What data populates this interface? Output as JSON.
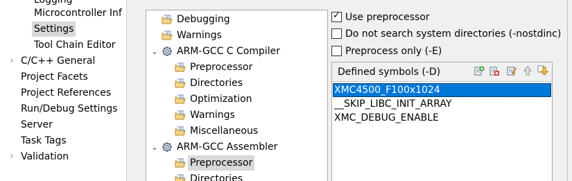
{
  "left_nav": {
    "items": [
      {
        "label": "Logging",
        "expandable": false
      },
      {
        "label": "Microcontroller Inf",
        "expandable": false
      },
      {
        "label": "Settings",
        "expandable": false,
        "selected": true
      },
      {
        "label": "Tool Chain Editor",
        "expandable": false
      },
      {
        "label": "C/C++ General",
        "expandable": true
      },
      {
        "label": "Project Facets",
        "expandable": false
      },
      {
        "label": "Project References",
        "expandable": false
      },
      {
        "label": "Run/Debug Settings",
        "expandable": false
      },
      {
        "label": "Server",
        "expandable": false
      },
      {
        "label": "Task Tags",
        "expandable": false
      },
      {
        "label": "Validation",
        "expandable": true
      }
    ]
  },
  "tool_tree": {
    "items": [
      {
        "label": "Debugging",
        "kind": "folder",
        "expandable": false
      },
      {
        "label": "Warnings",
        "kind": "folder",
        "expandable": false
      },
      {
        "label": "ARM-GCC C Compiler",
        "kind": "tool",
        "expandable": true,
        "expanded": true
      },
      {
        "label": "Preprocessor",
        "kind": "folder",
        "expandable": false
      },
      {
        "label": "Directories",
        "kind": "folder",
        "expandable": false
      },
      {
        "label": "Optimization",
        "kind": "folder",
        "expandable": false
      },
      {
        "label": "Warnings",
        "kind": "folder",
        "expandable": false
      },
      {
        "label": "Miscellaneous",
        "kind": "folder",
        "expandable": false
      },
      {
        "label": "ARM-GCC Assembler",
        "kind": "tool",
        "expandable": true,
        "expanded": true
      },
      {
        "label": "Preprocessor",
        "kind": "folder",
        "expandable": false,
        "selected": true
      },
      {
        "label": "Directories",
        "kind": "folder",
        "expandable": false
      }
    ]
  },
  "options": [
    {
      "label": "Use preprocessor",
      "checked": true
    },
    {
      "label": "Do not search system directories (-nostdinc)",
      "checked": false
    },
    {
      "label": "Preprocess only (-E)",
      "checked": false
    }
  ],
  "defined_symbols": {
    "title": "Defined symbols (-D)",
    "toolbar": [
      "add-icon",
      "delete-icon",
      "edit-icon",
      "move-up-icon",
      "move-down-icon"
    ],
    "items": [
      {
        "label": "XMC4500_F100x1024",
        "selected": true
      },
      {
        "label": "__SKIP_LIBC_INIT_ARRAY",
        "selected": false
      },
      {
        "label": "XMC_DEBUG_ENABLE",
        "selected": false
      }
    ]
  },
  "colors": {
    "selection_blue": "#0078d7",
    "tree_selection": "#d9d9d9",
    "panel_background": "#f0f0f0"
  }
}
